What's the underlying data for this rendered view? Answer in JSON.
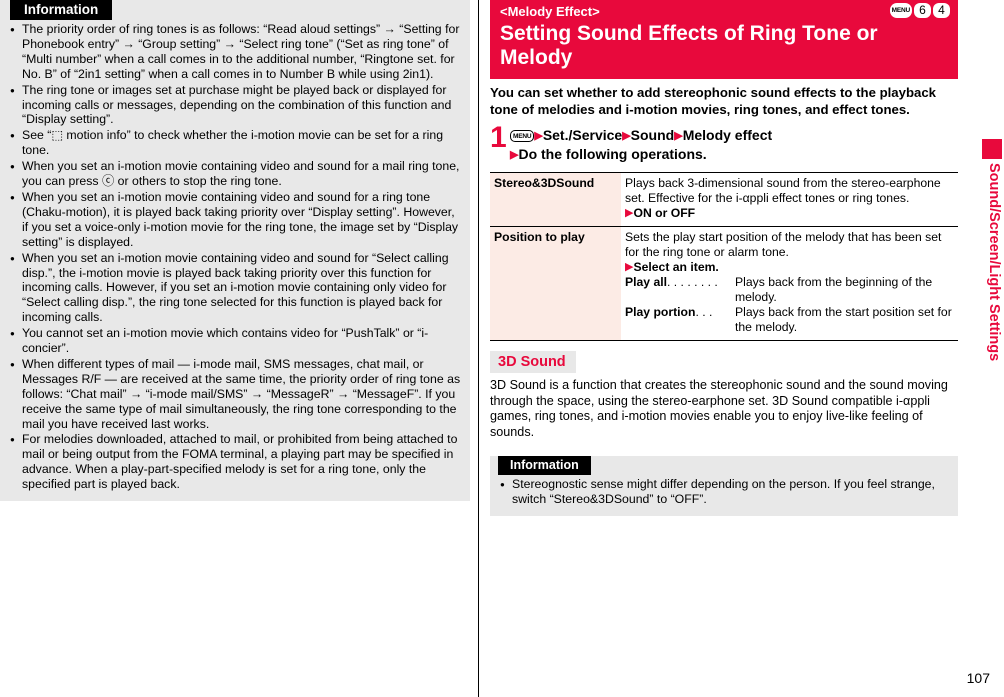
{
  "left": {
    "info": {
      "header": "Information",
      "bullets": [
        "The priority order of ring tones is as follows: “Read aloud settings” → “Setting for Phonebook entry” → “Group setting” → “Select ring tone” (“Set as ring tone” of “Multi number” when a call comes in to the additional number, “Ringtone set. for No. B” of “2in1 setting” when a call comes in to Number B while using 2in1).",
        "The ring tone or images set at purchase might be played back or displayed for incoming calls or messages, depending on the combination of this function and “Display setting”.",
        "See “⬚ motion info” to check whether the i-motion movie can be set for a ring tone.",
        "When you set an i-motion movie containing video and sound for a mail ring tone, you can press ⓒ or others to stop the ring tone.",
        "When you set an i-motion movie containing video and sound for a ring tone (Chaku-motion), it is played back taking priority over “Display setting”. However, if you set a voice-only i-motion movie for the ring tone, the image set by “Display setting” is displayed.",
        "When you set an i-motion movie containing video and sound for “Select calling disp.”, the i-motion movie is played back taking priority over this function for incoming calls. However, if you set an i-motion movie containing only video for “Select calling disp.”, the ring tone selected for this function is played back for incoming calls.",
        "You cannot set an i-motion movie which contains video for “PushTalk” or “i-concier”.",
        "When different types of mail — i-mode mail, SMS messages, chat mail, or Messages R/F — are received at the same time, the priority order of ring tone as follows: “Chat mail” → “i-mode mail/SMS” → “MessageR” → “MessageF”. If you receive the same type of mail simultaneously, the ring tone corresponding to the mail you have received last works.",
        "For melodies downloaded, attached to mail, or prohibited from being attached to mail or being output from the FOMA terminal, a playing part may be specified in advance. When a play-part-specified melody is set for a ring tone, only the specified part is played back."
      ]
    }
  },
  "right": {
    "banner": {
      "subtitle": "<Melody Effect>",
      "title": "Setting Sound Effects of Ring Tone or Melody",
      "keys": [
        "MENU",
        "6",
        "4"
      ]
    },
    "lead": "You can set whether to add stereophonic sound effects to the playback tone of melodies and i-motion movies, ring tones, and effect tones.",
    "step": {
      "number": "1",
      "key": "MENU",
      "line1_items": [
        "Set./Service",
        "Sound",
        "Melody effect"
      ],
      "line2": "Do the following operations."
    },
    "table": {
      "rows": [
        {
          "label": "Stereo&3DSound",
          "desc": "Plays back 3-dimensional sound from the stereo-earphone set. Effective for the i-αppli effect tones or ring tones.",
          "select": "ON or OFF",
          "defs": []
        },
        {
          "label": "Position to play",
          "desc": "Sets the play start position of the melody that has been set for the ring tone or alarm tone.",
          "select": "Select an item.",
          "defs": [
            {
              "term": "Play all",
              "dots": ". . . . . . . .",
              "def": "Plays back from the beginning of the melody."
            },
            {
              "term": "Play portion",
              "dots": ". . .",
              "def": "Plays back from the start position set for the melody."
            }
          ]
        }
      ]
    },
    "section": {
      "heading": "3D Sound",
      "body": "3D Sound is a function that creates the stereophonic sound and the sound moving through the space, using the stereo-earphone set. 3D Sound compatible i-αppli games, ring tones, and i-motion movies enable you to enjoy live-like feeling of sounds."
    },
    "info": {
      "header": "Information",
      "bullets": [
        "Stereognostic sense might differ depending on the person. If you feel strange, switch “Stereo&3DSound” to “OFF”."
      ]
    }
  },
  "side_tab": {
    "label": "Sound/Screen/Light Settings"
  },
  "page_number": "107",
  "colors": {
    "accent_red": "#e8093c",
    "info_bg": "#e8e8e8",
    "table_label_bg": "#fcebe5"
  }
}
